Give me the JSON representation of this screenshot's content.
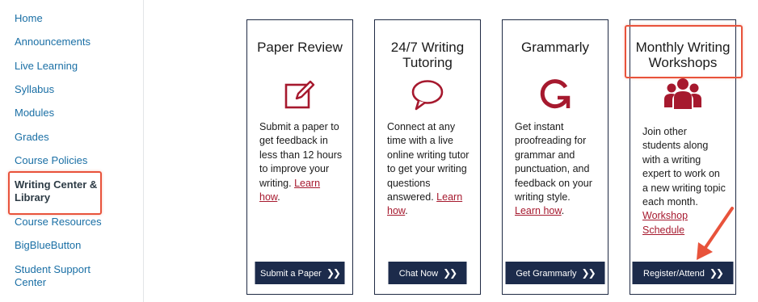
{
  "sidebar": {
    "items": [
      {
        "label": "Home"
      },
      {
        "label": "Announcements"
      },
      {
        "label": "Live Learning"
      },
      {
        "label": "Syllabus"
      },
      {
        "label": "Modules"
      },
      {
        "label": "Grades"
      },
      {
        "label": "Course Policies"
      },
      {
        "label": "Writing Center & Library",
        "active": true
      },
      {
        "label": "Course Resources"
      },
      {
        "label": "BigBlueButton"
      },
      {
        "label": "Student Support Center"
      }
    ]
  },
  "cards": [
    {
      "title": "Paper Review",
      "icon": "edit-icon",
      "description": "Submit a paper to get feedback in less than 12 hours to improve your writing.",
      "link_text": "Learn how",
      "link_suffix": ".",
      "button_label": "Submit a Paper"
    },
    {
      "title": "24/7 Writing Tutoring",
      "icon": "chat-bubble-icon",
      "description": "Connect at any time with a live online writing tutor to get your writing questions answered.",
      "link_text": "Learn how",
      "link_suffix": ".",
      "button_label": "Chat Now"
    },
    {
      "title": "Grammarly",
      "icon": "grammarly-g-icon",
      "description": "Get instant proofreading for grammar and punctuation, and feedback on your writing style.",
      "link_text": "Learn how",
      "link_suffix": ".",
      "button_label": "Get Grammarly"
    },
    {
      "title": "Monthly Writing Workshops",
      "icon": "group-users-icon",
      "description": "Join other students along with a writing expert to work on a new writing topic each month.",
      "link_text": "Workshop Schedule",
      "link_suffix": "",
      "button_label": "Register/Attend"
    }
  ],
  "colors": {
    "accent_red": "#a6192e",
    "nav_link": "#1a6fa5",
    "button_navy": "#1c2b4b",
    "highlight_annotation": "#e8533b"
  },
  "chevron_glyph": "❯❯"
}
